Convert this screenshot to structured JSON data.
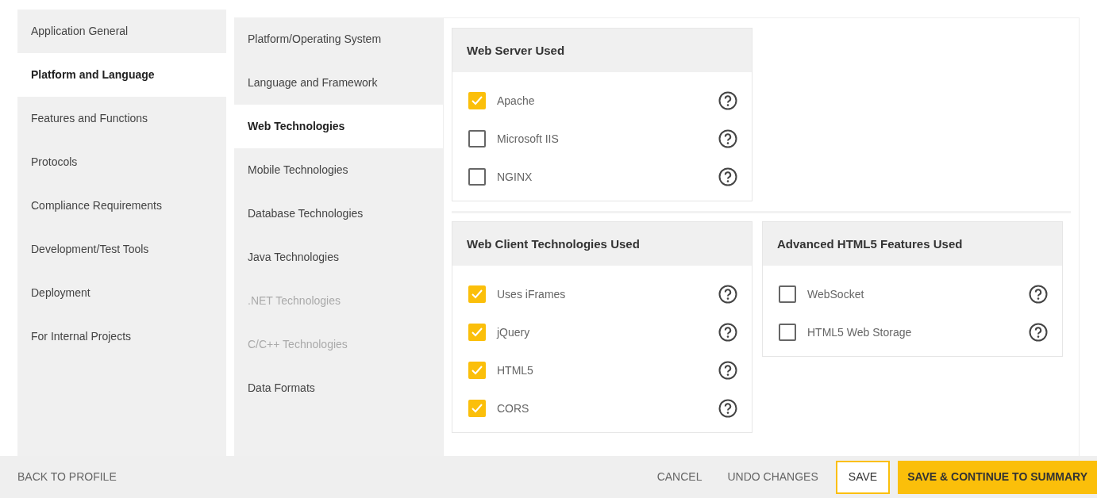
{
  "sections": [
    {
      "label": "Application General",
      "selected": false
    },
    {
      "label": "Platform and Language",
      "selected": true
    },
    {
      "label": "Features and Functions",
      "selected": false
    },
    {
      "label": "Protocols",
      "selected": false
    },
    {
      "label": "Compliance Requirements",
      "selected": false
    },
    {
      "label": "Development/Test Tools",
      "selected": false
    },
    {
      "label": "Deployment",
      "selected": false
    },
    {
      "label": "For Internal Projects",
      "selected": false
    }
  ],
  "subsections": [
    {
      "label": "Platform/Operating System",
      "selected": false,
      "disabled": false
    },
    {
      "label": "Language and Framework",
      "selected": false,
      "disabled": false
    },
    {
      "label": "Web Technologies",
      "selected": true,
      "disabled": false
    },
    {
      "label": "Mobile Technologies",
      "selected": false,
      "disabled": false
    },
    {
      "label": "Database Technologies",
      "selected": false,
      "disabled": false
    },
    {
      "label": "Java Technologies",
      "selected": false,
      "disabled": false
    },
    {
      "label": ".NET Technologies",
      "selected": false,
      "disabled": true
    },
    {
      "label": "C/C++ Technologies",
      "selected": false,
      "disabled": true
    },
    {
      "label": "Data Formats",
      "selected": false,
      "disabled": false
    }
  ],
  "panels": [
    [
      {
        "title": "Web Server Used",
        "options": [
          {
            "label": "Apache",
            "checked": true
          },
          {
            "label": "Microsoft IIS",
            "checked": false
          },
          {
            "label": "NGINX",
            "checked": false
          }
        ]
      }
    ],
    [
      {
        "title": "Web Client Technologies Used",
        "options": [
          {
            "label": "Uses iFrames",
            "checked": true
          },
          {
            "label": "jQuery",
            "checked": true
          },
          {
            "label": "HTML5",
            "checked": true
          },
          {
            "label": "CORS",
            "checked": true
          }
        ]
      },
      {
        "title": "Advanced HTML5 Features Used",
        "options": [
          {
            "label": "WebSocket",
            "checked": false
          },
          {
            "label": "HTML5 Web Storage",
            "checked": false
          }
        ]
      }
    ]
  ],
  "footer": {
    "back": "BACK TO PROFILE",
    "actions": [
      {
        "label": "CANCEL",
        "kind": "text"
      },
      {
        "label": "UNDO CHANGES",
        "kind": "text"
      },
      {
        "label": "SAVE",
        "kind": "outline"
      },
      {
        "label": "SAVE & CONTINUE TO SUMMARY",
        "kind": "primary"
      }
    ]
  }
}
